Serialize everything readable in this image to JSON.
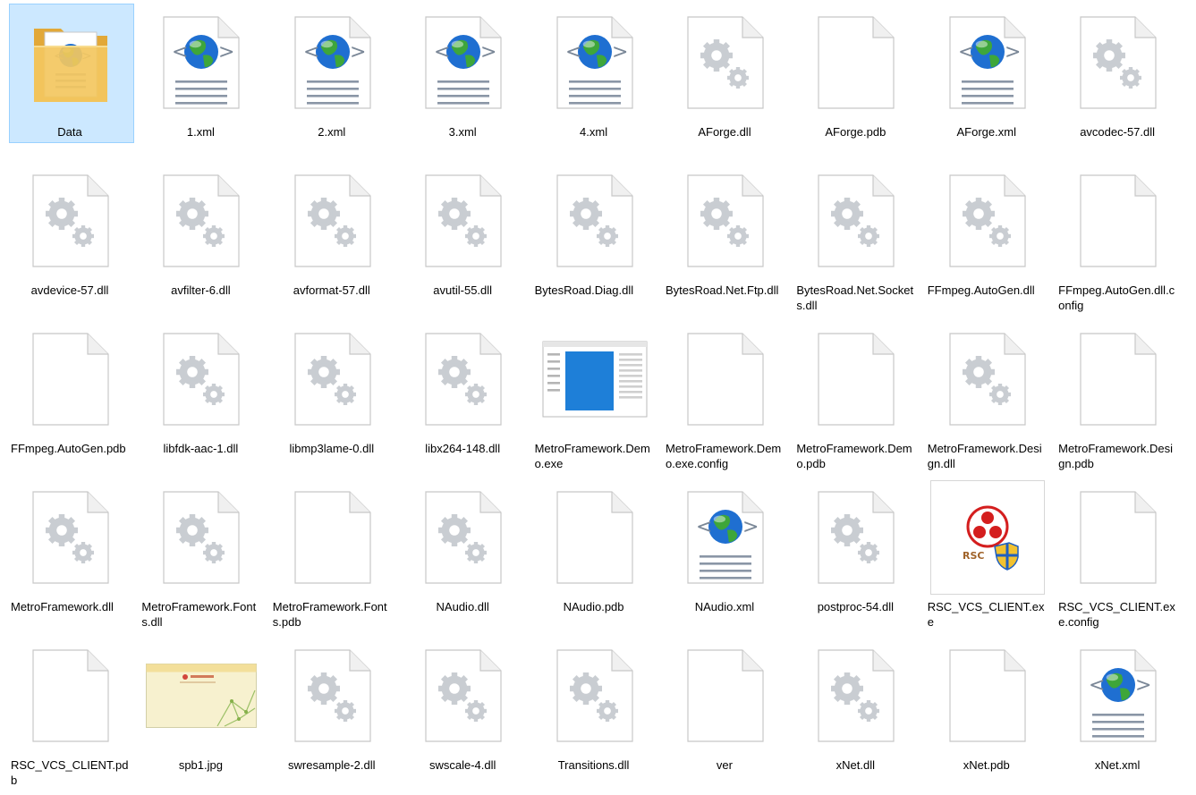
{
  "items": [
    {
      "name": "Data",
      "type": "folder",
      "selected": true
    },
    {
      "name": "1.xml",
      "type": "xml"
    },
    {
      "name": "2.xml",
      "type": "xml"
    },
    {
      "name": "3.xml",
      "type": "xml"
    },
    {
      "name": "4.xml",
      "type": "xml"
    },
    {
      "name": "AForge.dll",
      "type": "dll"
    },
    {
      "name": "AForge.pdb",
      "type": "blank"
    },
    {
      "name": "AForge.xml",
      "type": "xml"
    },
    {
      "name": "avcodec-57.dll",
      "type": "dll"
    },
    {
      "name": "avdevice-57.dll",
      "type": "dll"
    },
    {
      "name": "avfilter-6.dll",
      "type": "dll"
    },
    {
      "name": "avformat-57.dll",
      "type": "dll"
    },
    {
      "name": "avutil-55.dll",
      "type": "dll"
    },
    {
      "name": "BytesRoad.Diag.dll",
      "type": "dll"
    },
    {
      "name": "BytesRoad.Net.Ftp.dll",
      "type": "dll"
    },
    {
      "name": "BytesRoad.Net.Sockets.dll",
      "type": "dll"
    },
    {
      "name": "FFmpeg.AutoGen.dll",
      "type": "dll"
    },
    {
      "name": "FFmpeg.AutoGen.dll.config",
      "type": "blank"
    },
    {
      "name": "FFmpeg.AutoGen.pdb",
      "type": "blank"
    },
    {
      "name": "libfdk-aac-1.dll",
      "type": "dll"
    },
    {
      "name": "libmp3lame-0.dll",
      "type": "dll"
    },
    {
      "name": "libx264-148.dll",
      "type": "dll"
    },
    {
      "name": "MetroFramework.Demo.exe",
      "type": "app"
    },
    {
      "name": "MetroFramework.Demo.exe.config",
      "type": "blank"
    },
    {
      "name": "MetroFramework.Demo.pdb",
      "type": "blank"
    },
    {
      "name": "MetroFramework.Design.dll",
      "type": "dll"
    },
    {
      "name": "MetroFramework.Design.pdb",
      "type": "blank"
    },
    {
      "name": "MetroFramework.dll",
      "type": "dll"
    },
    {
      "name": "MetroFramework.Fonts.dll",
      "type": "dll"
    },
    {
      "name": "MetroFramework.Fonts.pdb",
      "type": "blank"
    },
    {
      "name": "NAudio.dll",
      "type": "dll"
    },
    {
      "name": "NAudio.pdb",
      "type": "blank"
    },
    {
      "name": "NAudio.xml",
      "type": "xml"
    },
    {
      "name": "postproc-54.dll",
      "type": "dll"
    },
    {
      "name": "RSC_VCS_CLIENT.exe",
      "type": "rsc"
    },
    {
      "name": "RSC_VCS_CLIENT.exe.config",
      "type": "blank"
    },
    {
      "name": "RSC_VCS_CLIENT.pdb",
      "type": "blank"
    },
    {
      "name": "spb1.jpg",
      "type": "jpg"
    },
    {
      "name": "swresample-2.dll",
      "type": "dll"
    },
    {
      "name": "swscale-4.dll",
      "type": "dll"
    },
    {
      "name": "Transitions.dll",
      "type": "dll"
    },
    {
      "name": "ver",
      "type": "blank"
    },
    {
      "name": "xNet.dll",
      "type": "dll"
    },
    {
      "name": "xNet.pdb",
      "type": "blank"
    },
    {
      "name": "xNet.xml",
      "type": "xml"
    }
  ],
  "icon_names": {
    "folder": "folder-icon",
    "xml": "xml-document-icon",
    "dll": "dll-gear-icon",
    "blank": "blank-file-icon",
    "app": "application-icon",
    "rsc": "rsc-app-icon",
    "jpg": "image-thumbnail-icon"
  },
  "colors": {
    "selection_bg": "#cce8ff",
    "selection_border": "#99d1ff",
    "folder": "#f3c75f",
    "globe_blue": "#1f6fd1",
    "globe_green": "#3ea63a",
    "gear": "#c9cdd2",
    "window_blue": "#1e7fd8"
  }
}
